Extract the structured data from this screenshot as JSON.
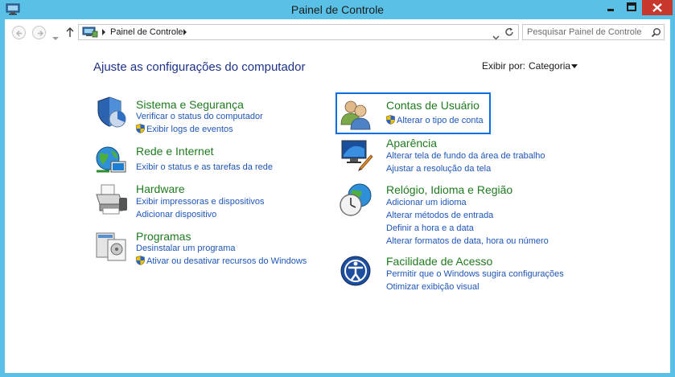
{
  "window": {
    "title": "Painel de Controle"
  },
  "address": {
    "crumb": "Painel de Controle",
    "search_placeholder": "Pesquisar Painel de Controle"
  },
  "header": {
    "heading": "Ajuste as configurações do computador",
    "view_by_label": "Exibir por:",
    "view_by_value": "Categoria"
  },
  "categories": {
    "sistema": {
      "title": "Sistema e Segurança",
      "links": [
        "Verificar o status do computador",
        "Exibir logs de eventos"
      ]
    },
    "rede": {
      "title": "Rede e Internet",
      "links": [
        "Exibir o status e as tarefas da rede"
      ]
    },
    "hardware": {
      "title": "Hardware",
      "links": [
        "Exibir impressoras e dispositivos",
        "Adicionar dispositivo"
      ]
    },
    "programas": {
      "title": "Programas",
      "links": [
        "Desinstalar um programa",
        "Ativar ou desativar recursos do Windows"
      ]
    },
    "contas": {
      "title": "Contas de Usuário",
      "links": [
        "Alterar o tipo de conta"
      ]
    },
    "aparencia": {
      "title": "Aparência",
      "links": [
        "Alterar tela de fundo da área de trabalho",
        "Ajustar a resolução da tela"
      ]
    },
    "relogio": {
      "title": "Relógio, Idioma e Região",
      "links": [
        "Adicionar um idioma",
        "Alterar métodos de entrada",
        "Definir a hora e a data",
        "Alterar formatos de data, hora ou número"
      ]
    },
    "facilidade": {
      "title": "Facilidade de Acesso",
      "links": [
        "Permitir que o Windows sugira configurações",
        "Otimizar exibição visual"
      ]
    }
  },
  "colors": {
    "frame": "#5bc0e6",
    "category_title": "#1f7a1f",
    "link": "#1e56b8",
    "heading": "#1e3287",
    "highlight": "#0a6ee6",
    "close_button": "#c7372b"
  }
}
